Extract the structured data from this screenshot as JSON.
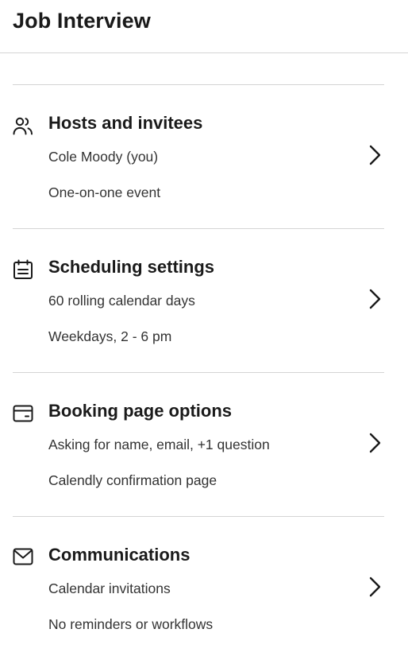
{
  "header": {
    "title": "Job Interview"
  },
  "sections": [
    {
      "title": "Hosts and invitees",
      "icon": "users-icon",
      "line1": "Cole Moody (you)",
      "line2": "One-on-one event"
    },
    {
      "title": "Scheduling settings",
      "icon": "calendar-icon",
      "line1": "60 rolling calendar days",
      "line2": "Weekdays, 2 - 6 pm"
    },
    {
      "title": "Booking page options",
      "icon": "browser-window-icon",
      "line1": "Asking for name, email, +1 question",
      "line2": "Calendly confirmation page"
    },
    {
      "title": "Communications",
      "icon": "envelope-icon",
      "line1": "Calendar invitations",
      "line2": "No reminders or workflows"
    }
  ],
  "colors": {
    "text": "#1a1a1a",
    "secondary_text": "#333333",
    "divider": "#d4d4d4",
    "background": "#ffffff"
  }
}
